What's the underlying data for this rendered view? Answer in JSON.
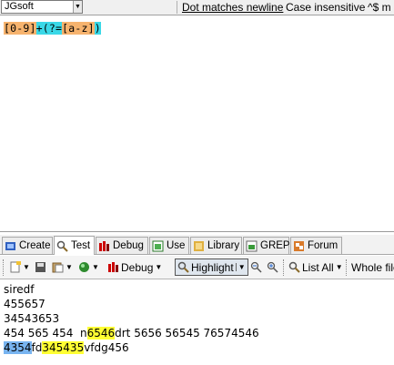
{
  "options": {
    "flavor": "JGsoft",
    "dot_matches_newline": "Dot matches newline",
    "case_insensitive": "Case insensitive",
    "anchors_match": "^$ m"
  },
  "regex": {
    "tokens": [
      {
        "text": "[0-9]",
        "kind": "class"
      },
      {
        "text": "+",
        "kind": "quant"
      },
      {
        "text": "(?=",
        "kind": "look"
      },
      {
        "text": "[a-z]",
        "kind": "inner"
      },
      {
        "text": ")",
        "kind": "look"
      }
    ]
  },
  "tabs": [
    {
      "label": "Create",
      "icon": "create-icon"
    },
    {
      "label": "Test",
      "icon": "magnifier-icon",
      "active": true
    },
    {
      "label": "Debug",
      "icon": "debug-icon"
    },
    {
      "label": "Use",
      "icon": "use-icon"
    },
    {
      "label": "Library",
      "icon": "library-icon"
    },
    {
      "label": "GREP",
      "icon": "grep-icon"
    },
    {
      "label": "Forum",
      "icon": "forum-icon"
    }
  ],
  "toolbar": {
    "debug_label": "Debug",
    "highlight_label": "Highlight",
    "list_all_label": "List All",
    "whole_file_label": "Whole file"
  },
  "subject": {
    "lines": [
      [
        {
          "text": "siredf"
        }
      ],
      [
        {
          "text": "455657"
        }
      ],
      [
        {
          "text": "34543653"
        }
      ],
      [
        {
          "text": "454 565 454  n"
        },
        {
          "text": "6546",
          "hl": "yellow"
        },
        {
          "text": "drt 5656 56545 76574546"
        }
      ],
      [
        {
          "text": "4354",
          "hl": "blue"
        },
        {
          "text": "fd"
        },
        {
          "text": "345435",
          "hl": "yellow"
        },
        {
          "text": "vfdg456"
        }
      ]
    ]
  },
  "colors": {
    "class_token": "#f6b36e",
    "group_token": "#3ad8e7",
    "match_highlight": "#ffff33",
    "selected_match": "#78b4f0"
  }
}
